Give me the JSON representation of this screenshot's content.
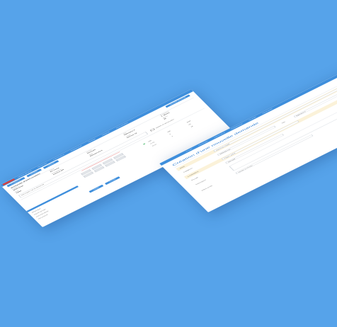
{
  "left_app": {
    "nav": [
      "Tableau de bord",
      "Demandes",
      "Interventions",
      "Équipements",
      "Contrats",
      "Rapports",
      "Administration"
    ],
    "toolbar": [
      "Enregistrer",
      "Modifier",
      "Clôturer"
    ],
    "toolbar_right": "Nouvelle demande",
    "pane_title": "Demande d'intervention",
    "fields": [
      {
        "label": "Numéro",
        "value": "2020-0142"
      },
      {
        "label": "Statut",
        "value": "En cours"
      },
      {
        "label": "Priorité",
        "value": "Normale"
      },
      {
        "label": "Site",
        "value": "Bâtiment A"
      },
      {
        "label": "Technicien",
        "value": "J. Martin"
      },
      {
        "label": "Date",
        "value": "12/03"
      },
      {
        "label": "Demandeur",
        "value": "Service RH"
      },
      {
        "label": "Type",
        "value": "Maintenance"
      },
      {
        "label": "Local",
        "value": "Bureau 12"
      },
      {
        "label": "Durée",
        "value": "2h"
      }
    ],
    "description": "Description de la demande",
    "checkbox_label": "Notifier le demandeur",
    "sidebar_items": [
      "Historique",
      "Pièces jointes",
      "Commentaires",
      "Documents"
    ],
    "footer_buttons": [
      "Valider",
      "Annuler"
    ],
    "table": [
      "Réf",
      "Qté",
      "Total",
      "A-12",
      "2",
      "40",
      "B-07",
      "1",
      "18"
    ]
  },
  "right_app": {
    "nav": [
      "Accueil",
      "Demandes",
      "Interventions",
      "Équipements",
      "Contrats",
      "Paramètres"
    ],
    "title": "Création d'une nouvelle demande",
    "rows": [
      {
        "label": "Objet",
        "input": "Saisissez l'objet"
      },
      {
        "label": "Catégorie",
        "select": "Sélectionner"
      },
      {
        "label": "Site",
        "select": "Bâtiment A"
      },
      {
        "label": "Localisation",
        "input": "Étage / pièce"
      },
      {
        "label": "Priorité",
        "select": "Normale"
      },
      {
        "label": "Description",
        "input": ""
      },
      {
        "label": "Pièce jointe",
        "input": "Ajouter un fichier"
      }
    ]
  }
}
